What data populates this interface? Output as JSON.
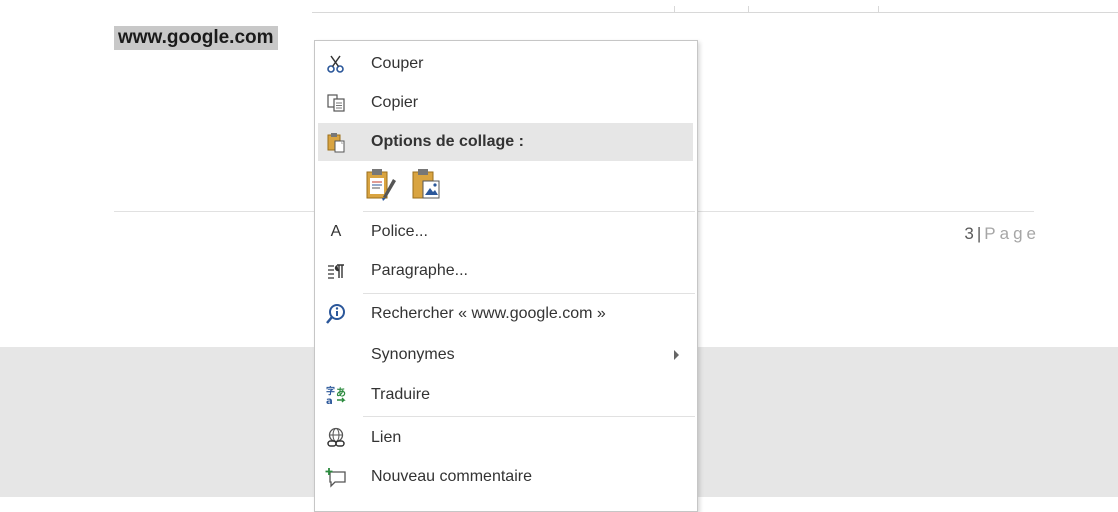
{
  "document": {
    "selected_text": "www.google.com",
    "page_number": "3",
    "page_separator": "|",
    "page_word": "Page"
  },
  "context_menu": {
    "items": [
      {
        "label": "Couper",
        "icon": "scissors-icon"
      },
      {
        "label": "Copier",
        "icon": "copy-icon"
      },
      {
        "label": "Options de collage :",
        "icon": "paste-icon"
      },
      {
        "label": "Police...",
        "icon": "font-icon"
      },
      {
        "label": "Paragraphe...",
        "icon": "paragraph-icon"
      },
      {
        "label": "Rechercher « www.google.com »",
        "icon": "smart-lookup-icon"
      },
      {
        "label": "Synonymes",
        "icon": ""
      },
      {
        "label": "Traduire",
        "icon": "translate-icon"
      },
      {
        "label": "Lien",
        "icon": "link-icon"
      },
      {
        "label": "Nouveau commentaire",
        "icon": "new-comment-icon"
      }
    ],
    "paste_options": [
      "keep-source-formatting-icon",
      "picture-paste-icon"
    ],
    "font_glyph": "A"
  },
  "colors": {
    "accent": "#2b579a",
    "paste_orange": "#d9a441",
    "selection": "#c8c8c8"
  }
}
